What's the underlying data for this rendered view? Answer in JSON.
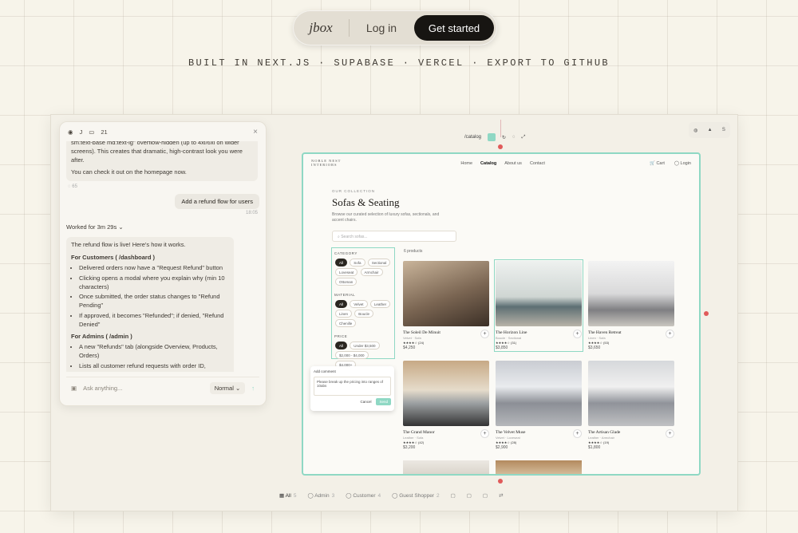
{
  "nav": {
    "brand": "jbox",
    "login": "Log in",
    "cta": "Get started"
  },
  "tagline": "BUILT IN NEXT.JS · SUPABASE · VERCEL · EXPORT TO GITHUB",
  "chat": {
    "header": {
      "user": "J",
      "count": "21",
      "close": "×"
    },
    "ai_intro": [
      "sm:text-base md:text-lg\" overflow-hidden (up to 4xl/6xl on wider screens). This creates that dramatic, high-contrast look you were after.",
      "You can check it out on the homepage now."
    ],
    "ai_meta": "65",
    "user_msg": "Add a refund flow for users",
    "user_time": "18:05",
    "worked": "Worked for 3m 29s",
    "reply_intro": "The refund flow is live! Here's how it works.",
    "customers_head": "For Customers ( /dashboard )",
    "customers_items": [
      "Delivered orders now have a \"Request Refund\" button",
      "Clicking opens a modal where you explain why (min 10 characters)",
      "Once submitted, the order status changes to \"Refund Pending\"",
      "If approved, it becomes \"Refunded\"; if denied, \"Refund Denied\""
    ],
    "admins_head": "For Admins ( /admin )",
    "admins_items": [
      "A new \"Refunds\" tab (alongside Overview, Products, Orders)",
      "Lists all customer refund requests with order ID,"
    ],
    "input_placeholder": "Ask anything...",
    "mode": "Normal"
  },
  "preview_tools": {
    "route": "/catalog"
  },
  "right_tools": {
    "label": "S"
  },
  "site": {
    "logo_line1": "NOBLE NEST",
    "logo_line2": "INTERIORS",
    "links": [
      "Home",
      "Catalog",
      "About us",
      "Contact"
    ],
    "cart": "Cart",
    "login": "Login",
    "kicker": "OUR COLLECTION",
    "title": "Sofas & Seating",
    "desc": "Browse our curated selection of luxury sofas, sectionals, and accent chairs.",
    "search_placeholder": "Search sofas...",
    "count": "6 products",
    "filters": {
      "category_label": "CATEGORY",
      "categories": [
        "All",
        "Sofa",
        "Sectional",
        "Loveseat",
        "Armchair",
        "Ottoman"
      ],
      "material_label": "MATERIAL",
      "materials": [
        "All",
        "Velvet",
        "Leather",
        "Linen",
        "Boucle",
        "Chenille"
      ],
      "price_label": "PRICE",
      "prices": [
        "All",
        "Under $3,500",
        "$2,000 - $4,000",
        "$4,000+"
      ]
    },
    "products": [
      {
        "name": "The Soleil De Minuit",
        "sub": "Velvet · Sofa",
        "stars": "★★★★☆ (24)",
        "price": "$4,250"
      },
      {
        "name": "The Horizon Line",
        "sub": "Boucle · Sectional",
        "stars": "★★★★☆ (31)",
        "price": "$3,850"
      },
      {
        "name": "The Haven Retreat",
        "sub": "Linen · Sofa",
        "stars": "★★★★☆ (53)",
        "price": "$3,650"
      },
      {
        "name": "The Grand Manor",
        "sub": "Leather · Sofa",
        "stars": "★★★★☆ (42)",
        "price": "$3,200"
      },
      {
        "name": "The Velvet Muse",
        "sub": "Velvet · Loveseat",
        "stars": "★★★★☆ (28)",
        "price": "$2,900"
      },
      {
        "name": "The Artisan Glade",
        "sub": "Leather · Armchair",
        "stars": "★★★★☆ (19)",
        "price": "$1,800"
      }
    ],
    "comment": {
      "title": "Add comment",
      "text": "Please break up the pricing into ranges of 10abs",
      "cancel": "Cancel",
      "send": "Send"
    }
  },
  "bottom_bar": [
    {
      "label": "All",
      "count": "5"
    },
    {
      "label": "Admin",
      "count": "3"
    },
    {
      "label": "Customer",
      "count": "4"
    },
    {
      "label": "Guest Shopper",
      "count": "2"
    }
  ],
  "colors": {
    "accent": "#8fd8c4",
    "dark": "#171512",
    "marker": "#e05a5a"
  }
}
